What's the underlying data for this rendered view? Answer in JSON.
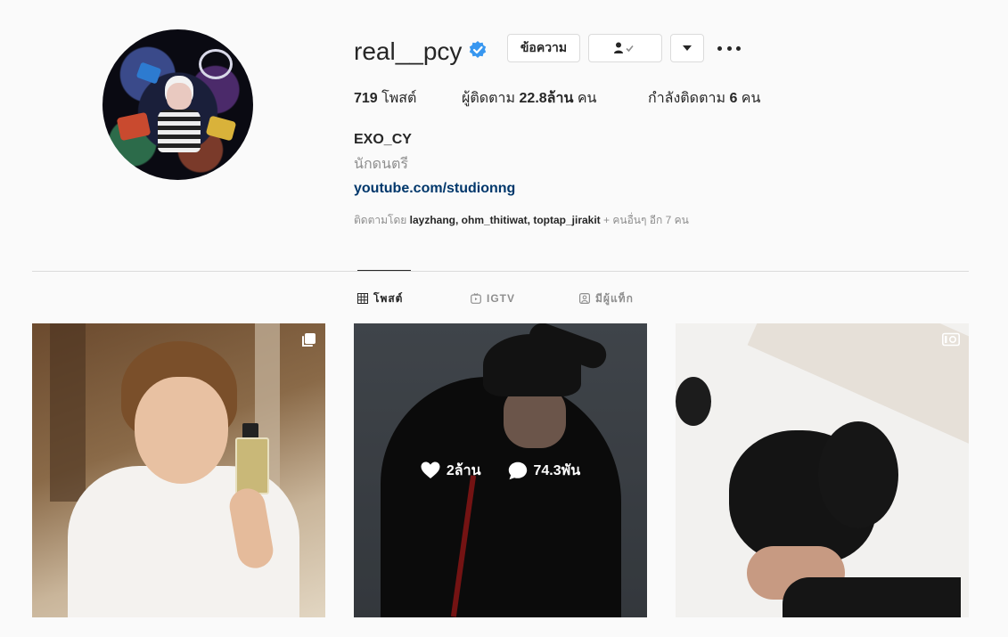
{
  "profile": {
    "username": "real__pcy",
    "buttons": {
      "message": "ข้อความ"
    },
    "stats": {
      "posts_count": "719",
      "posts_label": " โพสต์",
      "followers_label": "ผู้ติดตาม ",
      "followers_count": "22.8ล้าน",
      "followers_suffix": " คน",
      "following_label": "กำลังติดตาม ",
      "following_count": "6",
      "following_suffix": " คน"
    },
    "full_name": "EXO_CY",
    "category": "นักดนตรี",
    "link": "youtube.com/studionng",
    "followed_by": {
      "prefix": "ติดตามโดย ",
      "names": "layzhang, ohm_thitiwat, toptap_jirakit",
      "suffix": " + คนอื่นๆ อีก 7 คน"
    }
  },
  "tabs": [
    {
      "label": "โพสต์",
      "icon": "grid-icon",
      "active": true
    },
    {
      "label": "IGTV",
      "icon": "igtv-icon",
      "active": false
    },
    {
      "label": "มีผู้แท็ก",
      "icon": "tagged-icon",
      "active": false
    }
  ],
  "posts": [
    {
      "type": "carousel",
      "icon": "multiple-images-icon"
    },
    {
      "type": "image",
      "overlay": {
        "likes": "2ล้าน",
        "comments": "74.3พัน"
      }
    },
    {
      "type": "video",
      "icon": "video-icon"
    }
  ],
  "colors": {
    "background": "#fafafa",
    "text": "#262626",
    "secondary_text": "#8e8e8e",
    "link": "#00376b",
    "verified": "#3897f0",
    "border": "#dbdbdb"
  }
}
